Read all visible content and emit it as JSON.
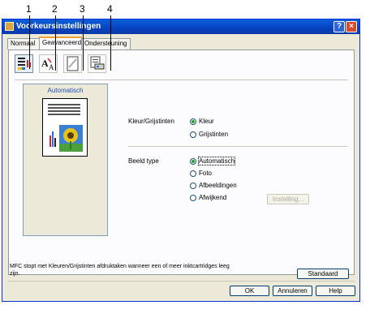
{
  "callouts": [
    "1",
    "2",
    "3",
    "4"
  ],
  "window": {
    "title": "Voorkeursinstellingen",
    "help_button": "?",
    "close_button": "×"
  },
  "tabs": [
    {
      "label": "Normaal",
      "active": false
    },
    {
      "label": "Geavanceerd",
      "active": true
    },
    {
      "label": "Ondersteuning",
      "active": false
    }
  ],
  "toolbar_icons": [
    "color-printer-icon",
    "font-icon",
    "watermark-icon",
    "device-options-icon"
  ],
  "preview": {
    "caption": "Automatisch",
    "sunflower_colors": {
      "petals": "#e5c21a",
      "center": "#5a3a12",
      "sky": "#3a7fd6",
      "grass": "#4aa03a"
    }
  },
  "color_section": {
    "label": "Kleur/Grijstinten",
    "options": [
      {
        "label": "Kleur",
        "selected": true
      },
      {
        "label": "Grijstinten",
        "selected": false
      }
    ]
  },
  "image_section": {
    "label": "Beeld type",
    "options": [
      {
        "label": "Automatisch",
        "selected": true
      },
      {
        "label": "Foto",
        "selected": false
      },
      {
        "label": "Afbeeldingen",
        "selected": false
      },
      {
        "label": "Afwijkend",
        "selected": false
      }
    ],
    "settings_button": "Instelling..."
  },
  "status_text": "MFC stopt met Kleuren/Grijstinten afdruktaken wanneer een of meer inktcartridges leeg zijn.",
  "buttons": {
    "default": "Standaard",
    "ok": "OK",
    "cancel": "Annuleren",
    "help": "Help"
  }
}
